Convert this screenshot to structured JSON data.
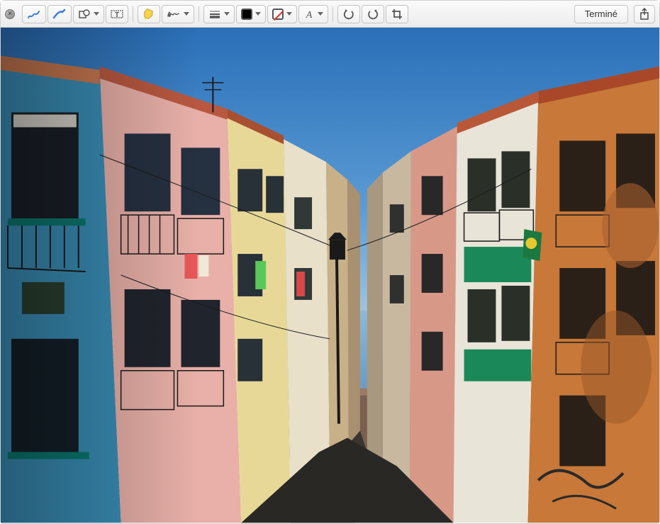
{
  "toolbar": {
    "done_label": "Terminé",
    "icons": {
      "close": "close",
      "sketch": "sketch",
      "draw": "draw",
      "shapes": "shapes",
      "text": "text",
      "highlight": "highlight",
      "sign": "sign",
      "line_style": "line-style",
      "border_color": "border-color",
      "fill_color": "fill-color",
      "text_style": "text-style",
      "rotate_left": "rotate-left",
      "rotate_right": "rotate-right",
      "crop": "crop",
      "share": "share"
    }
  },
  "colors": {
    "accent_blue": "#3b7be0",
    "highlight_yellow": "#f8d44c"
  }
}
